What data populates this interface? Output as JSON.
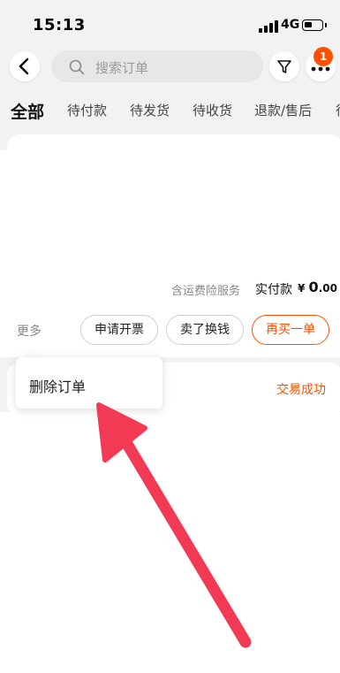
{
  "status_bar": {
    "time": "15:13",
    "network": "4G"
  },
  "header": {
    "search_placeholder": "搜索订单",
    "more_badge_count": "1"
  },
  "tabs": [
    "全部",
    "待付款",
    "待发货",
    "待收货",
    "退款/售后",
    "待"
  ],
  "order1": {
    "service_note": "含运费险服务",
    "paid_label": "实付款",
    "currency": "¥",
    "amount_int": "0",
    "amount_dec": ".00",
    "more_label": "更多",
    "buttons": [
      "申请开票",
      "卖了换钱",
      "再买一单"
    ]
  },
  "order2": {
    "status": "交易成功"
  },
  "popup_menu": {
    "items": [
      "删除订单"
    ]
  },
  "colors": {
    "accent": "#ff5000",
    "annotation_arrow": "#f23a54"
  },
  "icons": [
    "back-icon",
    "search-icon",
    "filter-icon",
    "more-dots-icon"
  ]
}
